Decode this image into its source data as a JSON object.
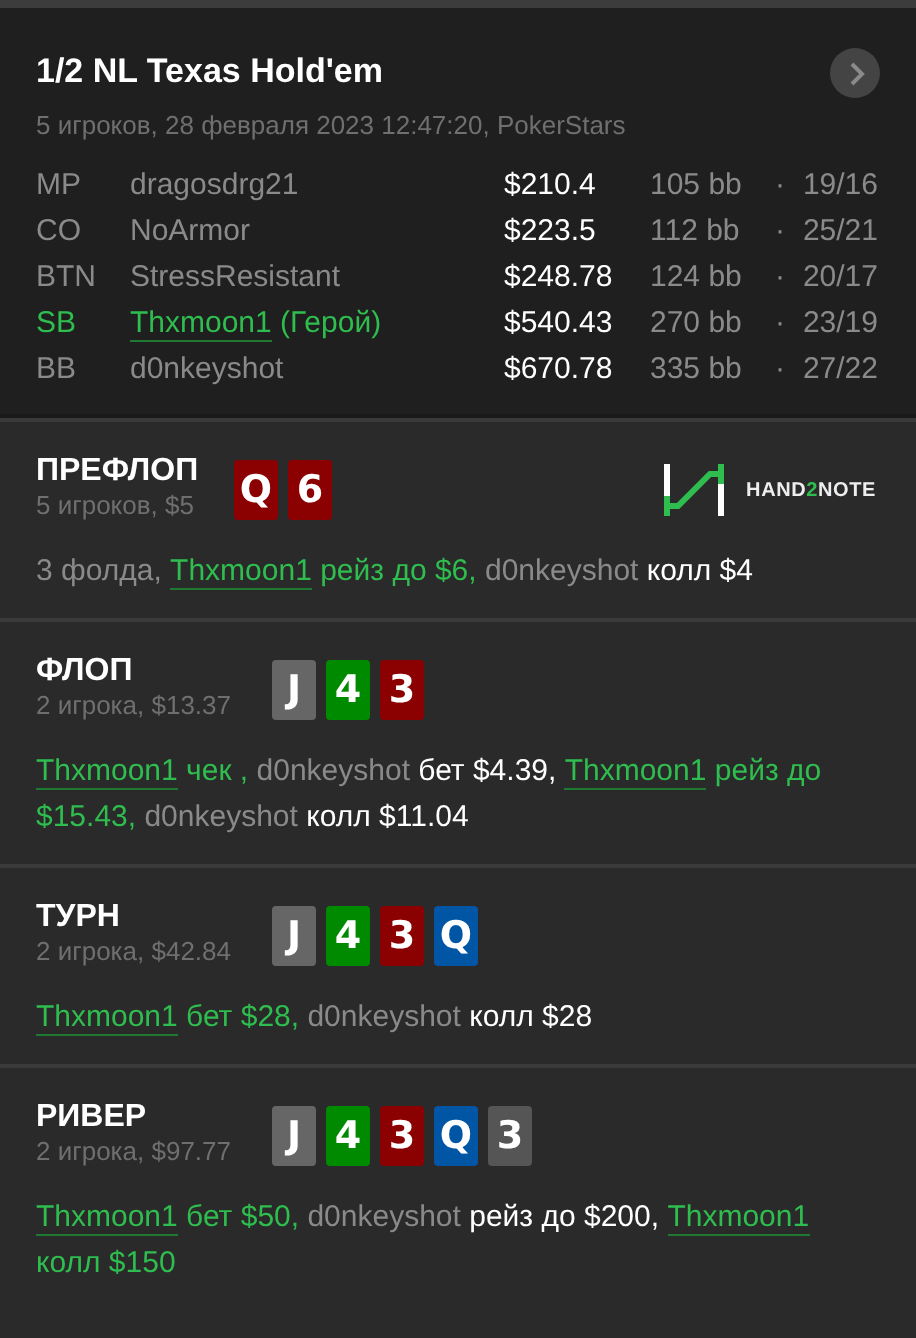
{
  "header": {
    "title": "1/2 NL Texas Hold'em",
    "subtitle": "5 игроков, 28 февраля 2023 12:47:20, PokerStars"
  },
  "players": [
    {
      "position": "MP",
      "name": "dragosdrg21",
      "hero": false,
      "stack": "$210.4",
      "bb": "105 bb",
      "separator": "·",
      "stats": "19/16"
    },
    {
      "position": "CO",
      "name": "NoArmor",
      "hero": false,
      "stack": "$223.5",
      "bb": "112 bb",
      "separator": "·",
      "stats": "25/21"
    },
    {
      "position": "BTN",
      "name": "StressResistant",
      "hero": false,
      "stack": "$248.78",
      "bb": "124 bb",
      "separator": "·",
      "stats": "20/17"
    },
    {
      "position": "SB",
      "name": "Thxmoon1",
      "hero": true,
      "hero_label": "(Герой)",
      "stack": "$540.43",
      "bb": "270 bb",
      "separator": "·",
      "stats": "23/19"
    },
    {
      "position": "BB",
      "name": "d0nkeyshot",
      "hero": false,
      "stack": "$670.78",
      "bb": "335 bb",
      "separator": "·",
      "stats": "27/22"
    }
  ],
  "streets": [
    {
      "title": "ПРЕФЛОП",
      "info": "5 игроков, $5",
      "logo": [
        "HAND",
        "2",
        "NOTE"
      ],
      "cards": [
        {
          "rank": "Q",
          "color": "#8b0000"
        },
        {
          "rank": "6",
          "color": "#8b0000"
        }
      ],
      "actions": [
        {
          "kind": "plain",
          "text": "3 фолда, "
        },
        {
          "kind": "hero",
          "text": "Thxmoon1"
        },
        {
          "kind": "hero_action",
          "text": " рейз до $6, "
        },
        {
          "kind": "plain",
          "text": "d0nkeyshot "
        },
        {
          "kind": "action",
          "text": "колл $4"
        }
      ]
    },
    {
      "title": "ФЛОП",
      "info": "2 игрока, $13.37",
      "cards": [
        {
          "rank": "J",
          "color": "#666666"
        },
        {
          "rank": "4",
          "color": "#008a00"
        },
        {
          "rank": "3",
          "color": "#8b0000"
        }
      ],
      "actions": [
        {
          "kind": "hero",
          "text": "Thxmoon1"
        },
        {
          "kind": "hero_action",
          "text": " чек , "
        },
        {
          "kind": "plain",
          "text": "d0nkeyshot "
        },
        {
          "kind": "action",
          "text": "бет $4.39, "
        },
        {
          "kind": "hero",
          "text": "Thxmoon1"
        },
        {
          "kind": "hero_action",
          "text": " рейз до $15.43, "
        },
        {
          "kind": "plain",
          "text": "d0nkeyshot "
        },
        {
          "kind": "action",
          "text": "колл $11.04"
        }
      ]
    },
    {
      "title": "ТУРН",
      "info": "2 игрока, $42.84",
      "cards": [
        {
          "rank": "J",
          "color": "#666666"
        },
        {
          "rank": "4",
          "color": "#008a00"
        },
        {
          "rank": "3",
          "color": "#8b0000"
        },
        {
          "rank": "Q",
          "color": "#0055a5"
        }
      ],
      "actions": [
        {
          "kind": "hero",
          "text": "Thxmoon1"
        },
        {
          "kind": "hero_action",
          "text": " бет $28, "
        },
        {
          "kind": "plain",
          "text": "d0nkeyshot "
        },
        {
          "kind": "action",
          "text": "колл $28"
        }
      ]
    },
    {
      "title": "РИВЕР",
      "info": "2 игрока, $97.77",
      "cards": [
        {
          "rank": "J",
          "color": "#666666"
        },
        {
          "rank": "4",
          "color": "#008a00"
        },
        {
          "rank": "3",
          "color": "#8b0000"
        },
        {
          "rank": "Q",
          "color": "#0055a5"
        },
        {
          "rank": "3",
          "color": "#555555"
        }
      ],
      "actions": [
        {
          "kind": "hero",
          "text": "Thxmoon1"
        },
        {
          "kind": "hero_action",
          "text": " бет $50, "
        },
        {
          "kind": "plain",
          "text": "d0nkeyshot "
        },
        {
          "kind": "action",
          "text": "рейз до $200, "
        },
        {
          "kind": "hero",
          "text": "Thxmoon1"
        },
        {
          "kind": "hero_action",
          "text": " колл $150"
        }
      ]
    }
  ]
}
